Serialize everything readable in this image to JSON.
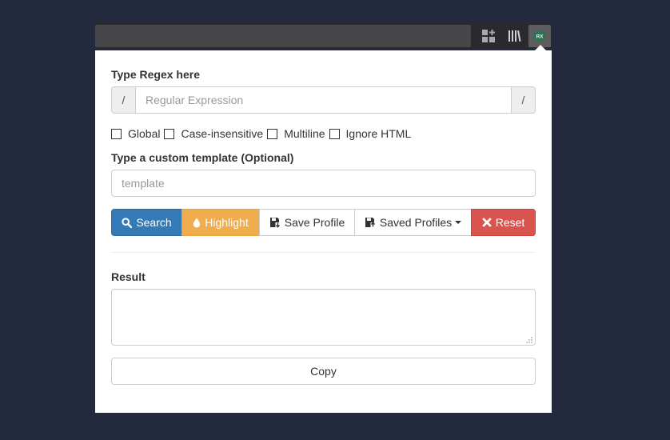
{
  "browser": {
    "toolbar_icons": [
      "extensions-icon",
      "library-icon",
      "regex-extension-icon"
    ],
    "extension_badge": "RX"
  },
  "panel": {
    "regex_label": "Type Regex here",
    "regex_prefix": "/",
    "regex_suffix": "/",
    "regex_value": "",
    "regex_placeholder": "Regular Expression",
    "flags": [
      {
        "label": "Global",
        "checked": false
      },
      {
        "label": "Case-insensitive",
        "checked": false
      },
      {
        "label": "Multiline",
        "checked": false
      },
      {
        "label": "Ignore HTML",
        "checked": false
      }
    ],
    "template_label": "Type a custom template (Optional)",
    "template_value": "",
    "template_placeholder": "template",
    "buttons": {
      "search": "Search",
      "highlight": "Highlight",
      "save_profile": "Save Profile",
      "saved_profiles": "Saved Profiles",
      "reset": "Reset"
    },
    "result_label": "Result",
    "result_value": "",
    "copy_label": "Copy"
  },
  "colors": {
    "page_background": "#242a3d",
    "primary": "#337ab7",
    "warning": "#f0ad4e",
    "danger": "#d9534f"
  }
}
